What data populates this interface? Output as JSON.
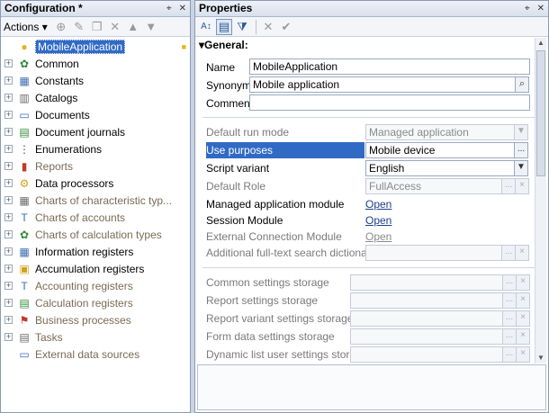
{
  "config_panel": {
    "title": "Configuration *",
    "actions_label": "Actions",
    "tree": [
      {
        "label": "MobileApplication",
        "icon": "app-icon",
        "selected": true,
        "dim": false,
        "expander": "none"
      },
      {
        "label": "Common",
        "icon": "common-icon",
        "dim": false,
        "expander": "+"
      },
      {
        "label": "Constants",
        "icon": "constants-icon",
        "dim": false,
        "expander": "+"
      },
      {
        "label": "Catalogs",
        "icon": "catalogs-icon",
        "dim": false,
        "expander": "+"
      },
      {
        "label": "Documents",
        "icon": "documents-icon",
        "dim": false,
        "expander": "+"
      },
      {
        "label": "Document journals",
        "icon": "document-journals-icon",
        "dim": false,
        "expander": "+"
      },
      {
        "label": "Enumerations",
        "icon": "enumerations-icon",
        "dim": false,
        "expander": "+"
      },
      {
        "label": "Reports",
        "icon": "reports-icon",
        "dim": true,
        "expander": "+"
      },
      {
        "label": "Data processors",
        "icon": "data-processors-icon",
        "dim": false,
        "expander": "+"
      },
      {
        "label": "Charts of characteristic typ...",
        "icon": "charts-characteristic-icon",
        "dim": true,
        "expander": "+"
      },
      {
        "label": "Charts of accounts",
        "icon": "charts-accounts-icon",
        "dim": true,
        "expander": "+"
      },
      {
        "label": "Charts of calculation types",
        "icon": "charts-calculation-icon",
        "dim": true,
        "expander": "+"
      },
      {
        "label": "Information registers",
        "icon": "information-registers-icon",
        "dim": false,
        "expander": "+"
      },
      {
        "label": "Accumulation registers",
        "icon": "accumulation-registers-icon",
        "dim": false,
        "expander": "+"
      },
      {
        "label": "Accounting registers",
        "icon": "accounting-registers-icon",
        "dim": true,
        "expander": "+"
      },
      {
        "label": "Calculation registers",
        "icon": "calculation-registers-icon",
        "dim": true,
        "expander": "+"
      },
      {
        "label": "Business processes",
        "icon": "business-processes-icon",
        "dim": true,
        "expander": "+"
      },
      {
        "label": "Tasks",
        "icon": "tasks-icon",
        "dim": true,
        "expander": "+"
      },
      {
        "label": "External data sources",
        "icon": "external-data-sources-icon",
        "dim": true,
        "expander": "none"
      }
    ]
  },
  "properties_panel": {
    "title": "Properties",
    "section_general": "General:",
    "name_label": "Name",
    "name_value": "MobileApplication",
    "synonym_label": "Synonym",
    "synonym_value": "Mobile application",
    "comment_label": "Comment",
    "comment_value": "",
    "default_run_mode_label": "Default run mode",
    "default_run_mode_value": "Managed application",
    "use_purposes_label": "Use purposes",
    "use_purposes_value": "Mobile device",
    "script_variant_label": "Script variant",
    "script_variant_value": "English",
    "default_role_label": "Default Role",
    "default_role_value": "FullAccess",
    "managed_app_module_label": "Managed application module",
    "managed_app_module_link": "Open",
    "session_module_label": "Session Module",
    "session_module_link": "Open",
    "external_connection_module_label": "External Connection Module",
    "external_connection_module_link": "Open",
    "fulltext_dictionaries_label": "Additional full-text search dictionaries",
    "common_settings_label": "Common settings storage",
    "report_settings_label": "Report settings storage",
    "report_variant_settings_label": "Report variant settings storage",
    "form_data_settings_label": "Form data settings storage",
    "dynamic_list_settings_label": "Dynamic list user settings storage",
    "ellipsis": "...",
    "clear": "×"
  },
  "colors": {
    "accent": "#316ac5",
    "annotation": "#e01818"
  }
}
